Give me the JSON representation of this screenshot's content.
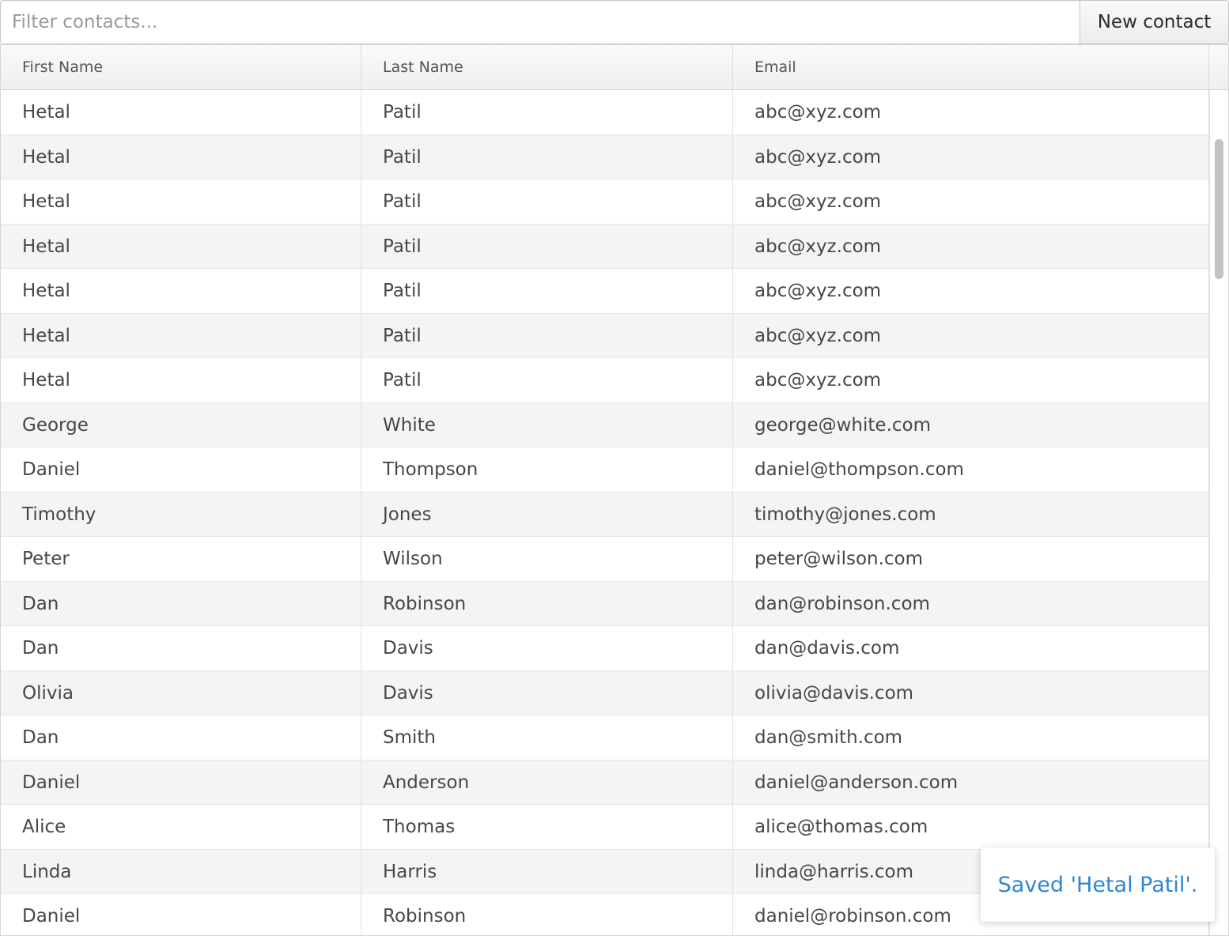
{
  "toolbar": {
    "filter_placeholder": "Filter contacts...",
    "filter_value": "",
    "new_contact_label": "New contact"
  },
  "grid": {
    "columns": [
      "First Name",
      "Last Name",
      "Email"
    ],
    "rows": [
      [
        "Hetal",
        "Patil",
        "abc@xyz.com"
      ],
      [
        "Hetal",
        "Patil",
        "abc@xyz.com"
      ],
      [
        "Hetal",
        "Patil",
        "abc@xyz.com"
      ],
      [
        "Hetal",
        "Patil",
        "abc@xyz.com"
      ],
      [
        "Hetal",
        "Patil",
        "abc@xyz.com"
      ],
      [
        "Hetal",
        "Patil",
        "abc@xyz.com"
      ],
      [
        "Hetal",
        "Patil",
        "abc@xyz.com"
      ],
      [
        "George",
        "White",
        "george@white.com"
      ],
      [
        "Daniel",
        "Thompson",
        "daniel@thompson.com"
      ],
      [
        "Timothy",
        "Jones",
        "timothy@jones.com"
      ],
      [
        "Peter",
        "Wilson",
        "peter@wilson.com"
      ],
      [
        "Dan",
        "Robinson",
        "dan@robinson.com"
      ],
      [
        "Dan",
        "Davis",
        "dan@davis.com"
      ],
      [
        "Olivia",
        "Davis",
        "olivia@davis.com"
      ],
      [
        "Dan",
        "Smith",
        "dan@smith.com"
      ],
      [
        "Daniel",
        "Anderson",
        "daniel@anderson.com"
      ],
      [
        "Alice",
        "Thomas",
        "alice@thomas.com"
      ],
      [
        "Linda",
        "Harris",
        "linda@harris.com"
      ],
      [
        "Daniel",
        "Robinson",
        "daniel@robinson.com"
      ]
    ]
  },
  "notification": {
    "message": "Saved 'Hetal Patil'."
  },
  "colors": {
    "accent": "#2e86d4",
    "row_alt": "#f4f4f4"
  }
}
